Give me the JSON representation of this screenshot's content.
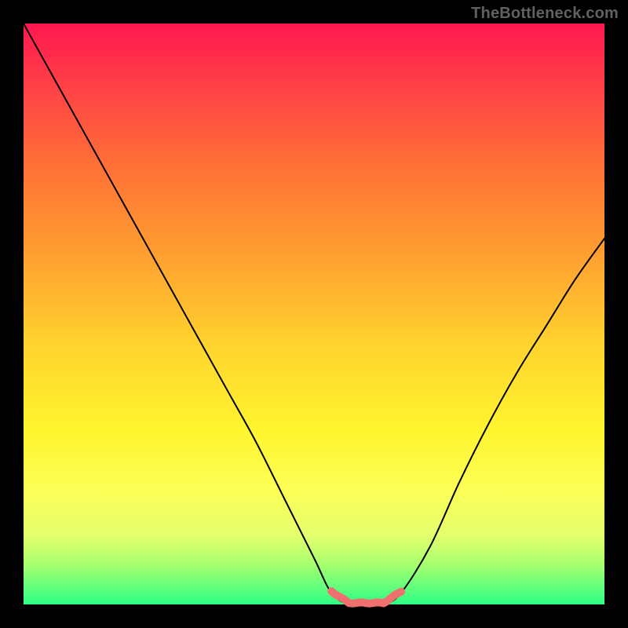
{
  "watermark": "TheBottleneck.com",
  "colors": {
    "background": "#000000",
    "gradient_top": "#ff1750",
    "gradient_bottom": "#2eff84",
    "curve": "#000000",
    "highlight": "#f07070",
    "watermark_text": "#616161"
  },
  "chart_data": {
    "type": "line",
    "title": "",
    "xlabel": "",
    "ylabel": "",
    "x": [
      0,
      5,
      10,
      15,
      20,
      25,
      30,
      35,
      40,
      45,
      50,
      53,
      56,
      59,
      62,
      65,
      70,
      75,
      80,
      85,
      90,
      95,
      100
    ],
    "values": [
      100,
      91,
      82,
      73,
      64,
      55,
      46,
      37,
      28,
      18,
      8,
      2,
      0,
      0,
      0,
      2,
      10,
      21,
      31,
      40,
      48,
      56,
      63
    ],
    "xlim": [
      0,
      100
    ],
    "ylim": [
      0,
      100
    ],
    "annotations": [
      {
        "type": "highlight-range",
        "x_start": 53,
        "x_end": 65,
        "label": ""
      }
    ],
    "notes": "V-shaped bottleneck curve; green (low y) is optimal, red (high y) is heavy bottleneck. Flat minimum segment highlighted in muted red."
  }
}
